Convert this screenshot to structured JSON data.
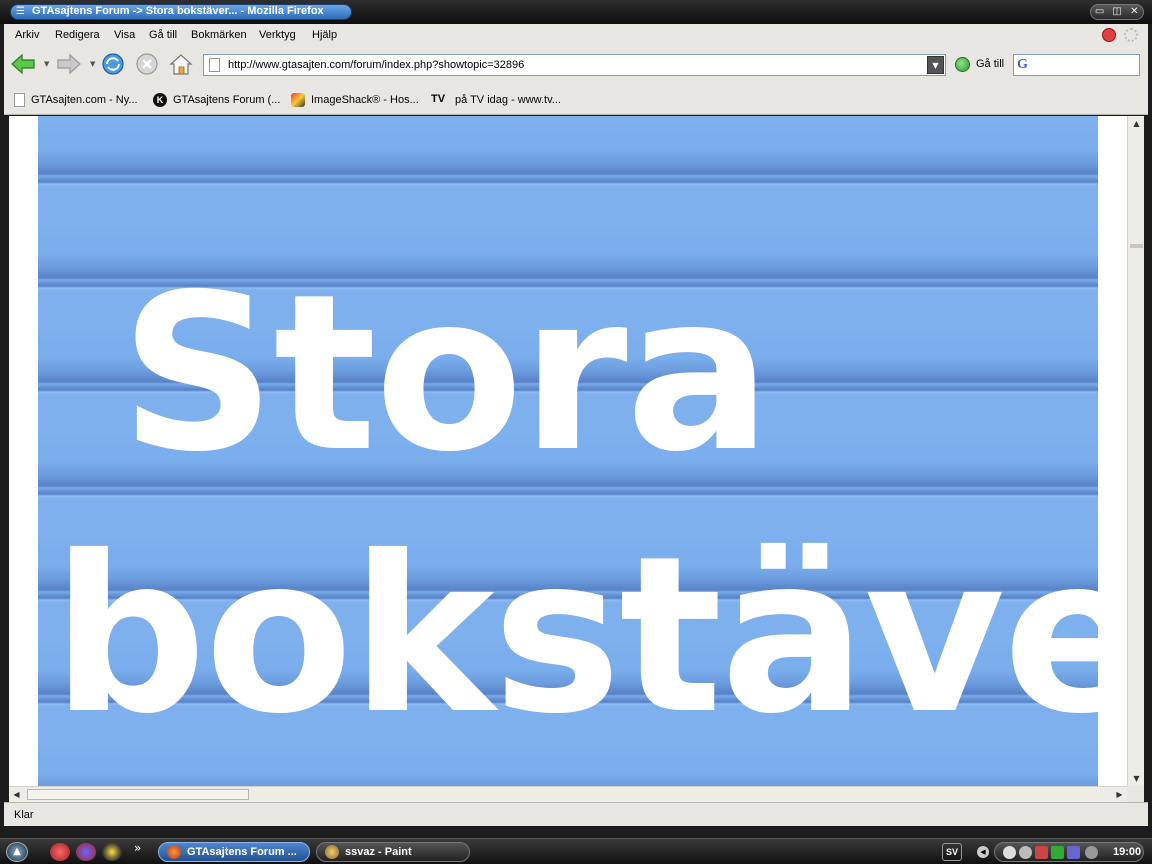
{
  "window": {
    "title": "GTAsajtens Forum -> Stora bokstäver... - Mozilla Firefox"
  },
  "menubar": {
    "items": [
      "Arkiv",
      "Redigera",
      "Visa",
      "Gå till",
      "Bokmärken",
      "Verktyg",
      "Hjälp"
    ]
  },
  "navbar": {
    "url": "http://www.gtasajten.com/forum/index.php?showtopic=32896",
    "go_label": "Gå till"
  },
  "bookmarks": [
    {
      "label": "GTAsajten.com - Ny...",
      "icon": "page-icon"
    },
    {
      "label": "GTAsajtens Forum (...",
      "icon": "k-logo-icon"
    },
    {
      "label": "ImageShack® - Hos...",
      "icon": "imageshack-icon"
    },
    {
      "label": "på TV idag - www.tv...",
      "icon": "tv-icon",
      "icon_text": "TV"
    }
  ],
  "content": {
    "line1": "Stora",
    "line2": "bokstäve",
    "colors": {
      "banner_blue": "#7eb0ee",
      "stripe_dark": "#5782c6",
      "text": "#ffffff"
    }
  },
  "statusbar": {
    "text": "Klar"
  },
  "taskbar": {
    "tasks": [
      {
        "label": "GTAsajtens Forum ...",
        "active": true
      },
      {
        "label": "ssvaz - Paint",
        "active": false
      }
    ],
    "language": "SV",
    "clock": "19:00"
  }
}
